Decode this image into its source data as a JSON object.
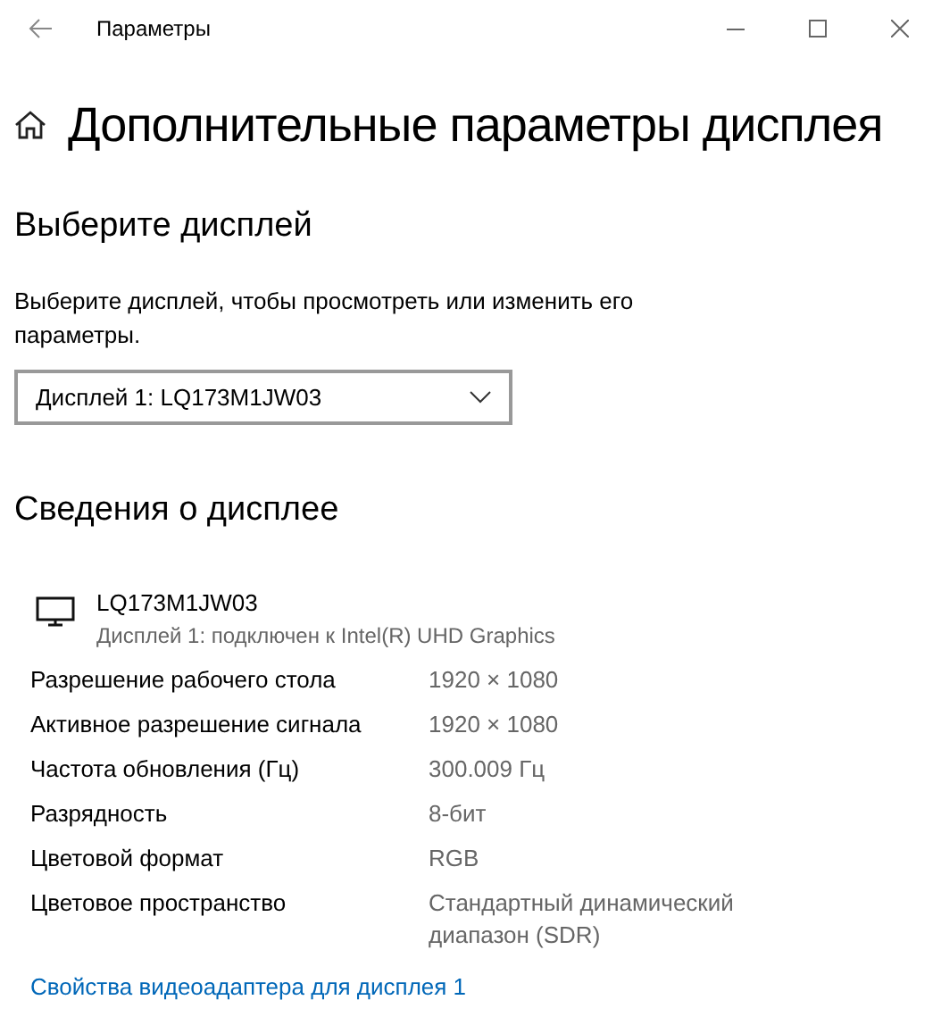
{
  "window": {
    "title": "Параметры"
  },
  "page_title": "Дополнительные параметры дисплея",
  "select_display": {
    "heading": "Выберите дисплей",
    "description": "Выберите дисплей, чтобы просмотреть или изменить его параметры.",
    "dropdown_value": "Дисплей 1: LQ173M1JW03"
  },
  "display_info": {
    "heading": "Сведения о дисплее",
    "monitor_name": "LQ173M1JW03",
    "monitor_subtitle": "Дисплей 1: подключен к Intel(R) UHD Graphics",
    "rows": [
      {
        "label": "Разрешение рабочего стола",
        "value": "1920 × 1080"
      },
      {
        "label": "Активное разрешение сигнала",
        "value": "1920 × 1080"
      },
      {
        "label": "Частота обновления (Гц)",
        "value": "300.009 Гц"
      },
      {
        "label": "Разрядность",
        "value": "8-бит"
      },
      {
        "label": "Цветовой формат",
        "value": "RGB"
      },
      {
        "label": "Цветовое пространство",
        "value": "Стандартный динамический диапазон (SDR)"
      }
    ],
    "link": "Свойства видеоадаптера для дисплея 1"
  }
}
